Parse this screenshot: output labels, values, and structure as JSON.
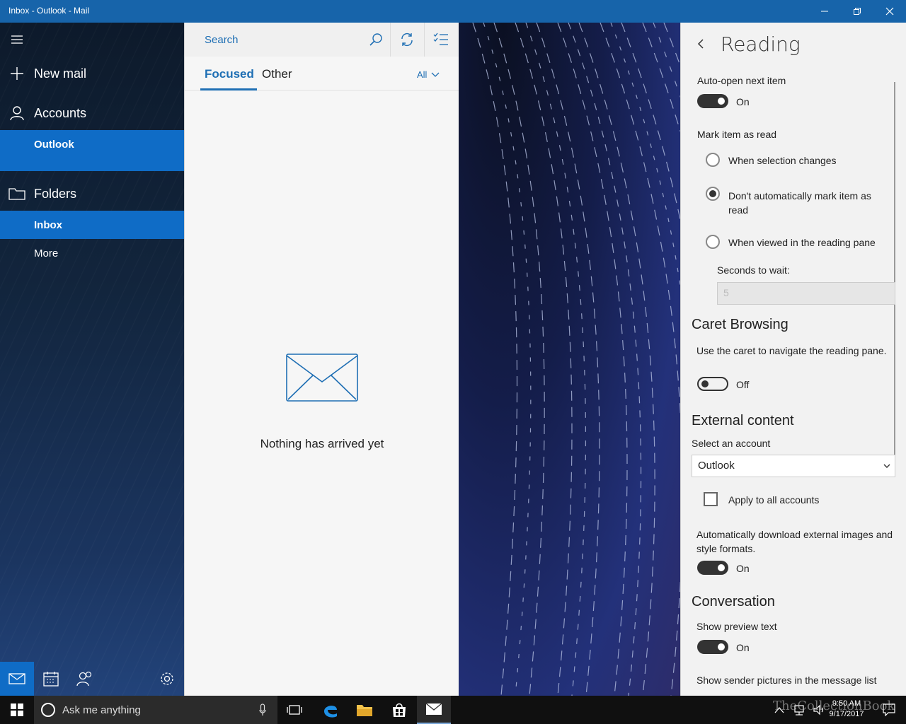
{
  "window": {
    "title": "Inbox - Outlook - Mail"
  },
  "nav": {
    "new_mail": "New mail",
    "accounts": "Accounts",
    "account_name": "Outlook",
    "folders": "Folders",
    "inbox": "Inbox",
    "more": "More"
  },
  "list": {
    "search_placeholder": "Search",
    "tab_focused": "Focused",
    "tab_other": "Other",
    "filter": "All",
    "empty_message": "Nothing has arrived yet"
  },
  "settings": {
    "title": "Reading",
    "auto_open_label": "Auto-open next item",
    "auto_open_state": "On",
    "mark_read_label": "Mark item as read",
    "radio_options": [
      "When selection changes",
      "Don't automatically mark item as read",
      "When viewed in the reading pane"
    ],
    "radio_selected_index": 1,
    "seconds_label": "Seconds to wait:",
    "seconds_value": "5",
    "caret_heading": "Caret Browsing",
    "caret_desc": "Use the caret to navigate the reading pane.",
    "caret_state": "Off",
    "external_heading": "External content",
    "select_account_label": "Select an account",
    "selected_account": "Outlook",
    "apply_all_label": "Apply to all accounts",
    "auto_download_label": "Automatically download external images and style formats.",
    "auto_download_state": "On",
    "conversation_heading": "Conversation",
    "preview_label": "Show preview text",
    "preview_state": "On",
    "sender_pictures_label": "Show sender pictures in the message list"
  },
  "taskbar": {
    "search_placeholder": "Ask me anything",
    "time": "9:50 AM",
    "date": "9/17/2017",
    "watermark": "TheCollectionBook"
  },
  "colors": {
    "accent": "#0f6cc6",
    "titlebar": "#1764aa",
    "link": "#1f6fb4"
  }
}
